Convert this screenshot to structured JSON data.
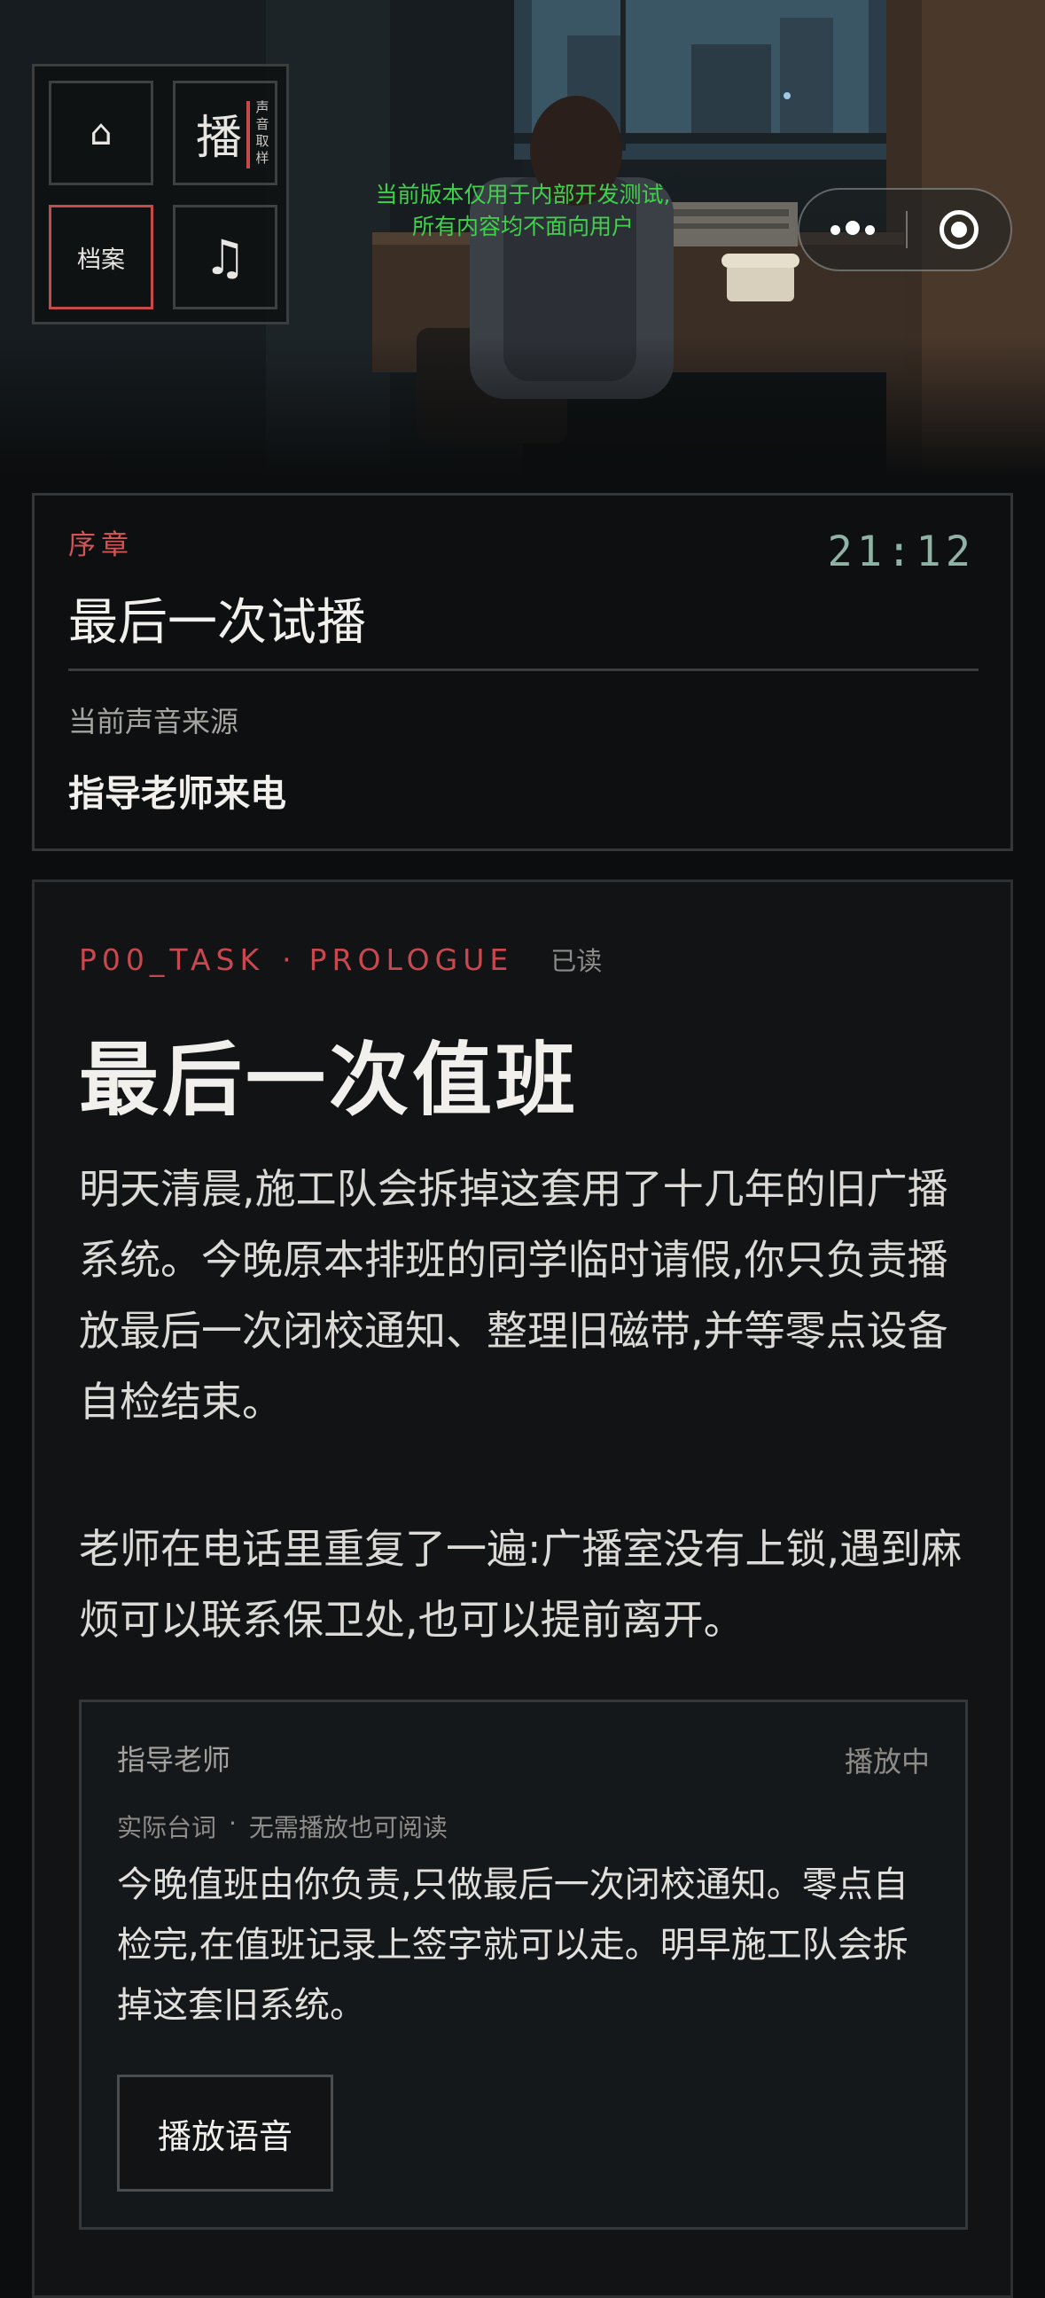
{
  "hero": {
    "notice_line1": "当前版本仅用于内部开发测试,",
    "notice_line2": "所有内容均不面向用户"
  },
  "nav": {
    "home_icon": "home-icon",
    "broadcast_label": "播",
    "broadcast_sub": [
      "声",
      "音",
      "取",
      "样"
    ],
    "archive_label": "档案",
    "music_icon": "music-note-icon"
  },
  "capsule": {
    "more_icon": "more-dots-icon",
    "close_icon": "target-close-icon"
  },
  "status": {
    "chapter_tag": "序章",
    "chapter_title": "最后一次试播",
    "clock": "21:12",
    "source_label": "当前声音来源",
    "source_value": "指导老师来电"
  },
  "story": {
    "task_code": "P00_TASK",
    "task_sep": "·",
    "task_name": "PROLOGUE",
    "read_state": "已读",
    "title": "最后一次值班",
    "paragraph1": "明天清晨,施工队会拆掉这套用了十几年的旧广播系统。今晚原本排班的同学临时请假,你只负责播放最后一次闭校通知、整理旧磁带,并等零点设备自检结束。",
    "paragraph2": "老师在电话里重复了一遍:广播室没有上锁,遇到麻烦可以联系保卫处,也可以提前离开。"
  },
  "dialog": {
    "speaker": "指导老师",
    "state": "播放中",
    "sub_label": "实际台词",
    "sub_sep": "·",
    "sub_hint": "无需播放也可阅读",
    "line": "今晚值班由你负责,只做最后一次闭校通知。零点自检完,在值班记录上签字就可以走。明早施工队会拆掉这套旧系统。",
    "play_button": "播放语音"
  },
  "colors": {
    "accent_red": "#d45555",
    "notice_green": "#3fd24a",
    "clock_teal": "#8fb2a4",
    "background": "#0b0d0e"
  }
}
